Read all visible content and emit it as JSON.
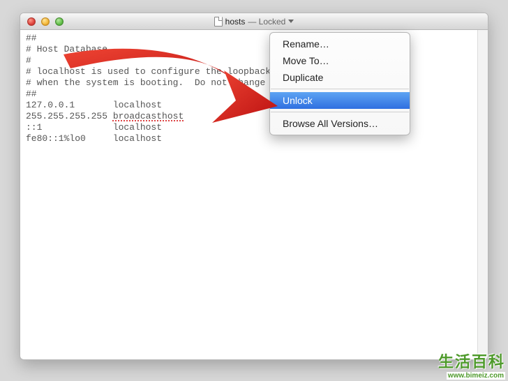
{
  "titlebar": {
    "filename": "hosts",
    "status": "— Locked"
  },
  "file_content": {
    "lines": [
      "##",
      "# Host Database",
      "#",
      "# localhost is used to configure the loopback interface",
      "# when the system is booting.  Do not change this entry.",
      "##",
      "127.0.0.1       localhost",
      "255.255.255.255 broadcasthost",
      "::1             localhost",
      "fe80::1%lo0     localhost"
    ],
    "spelled_error_token": "broadcasthost"
  },
  "menu": {
    "items": [
      {
        "label": "Rename…",
        "separator_after": false
      },
      {
        "label": "Move To…",
        "separator_after": false
      },
      {
        "label": "Duplicate",
        "separator_after": true
      },
      {
        "label": "Unlock",
        "separator_after": true
      },
      {
        "label": "Browse All Versions…",
        "separator_after": false
      }
    ],
    "highlighted_index": 3
  },
  "watermark": {
    "line1": "生活百科",
    "line2": "www.bimeiz.com"
  }
}
